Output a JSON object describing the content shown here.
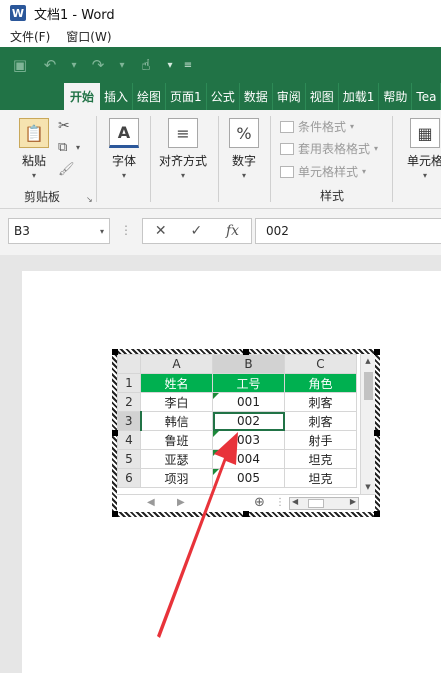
{
  "window": {
    "title": "文档1 - Word",
    "logo": "W"
  },
  "menu": [
    "文件(F)",
    "窗口(W)"
  ],
  "tabs": [
    "开始",
    "插入",
    "绘图",
    "页面1",
    "公式",
    "数据",
    "审阅",
    "视图",
    "加载1",
    "帮助",
    "Tea"
  ],
  "ribbon": {
    "clipboard": {
      "paste": "粘贴",
      "label": "剪贴板"
    },
    "font": "字体",
    "alignment": "对齐方式",
    "number": "数字",
    "number_symbol": "%",
    "styles": {
      "conditional": "条件格式",
      "table": "套用表格格式",
      "cell": "单元格样式",
      "label": "样式"
    },
    "cells": "单元格"
  },
  "formula_bar": {
    "name_box": "B3",
    "fx": "fx",
    "value": "002"
  },
  "sheet": {
    "columns": [
      "A",
      "B",
      "C"
    ],
    "rows": [
      "1",
      "2",
      "3",
      "4",
      "5",
      "6"
    ],
    "header": [
      "姓名",
      "工号",
      "角色"
    ],
    "data": [
      [
        "李白",
        "001",
        "刺客"
      ],
      [
        "韩信",
        "002",
        "刺客"
      ],
      [
        "鲁班",
        "003",
        "射手"
      ],
      [
        "亚瑟",
        "004",
        "坦克"
      ],
      [
        "项羽",
        "005",
        "坦克"
      ]
    ]
  },
  "colors": {
    "excel_green": "#217346",
    "header_green": "#00b050",
    "arrow_red": "#e8333a"
  }
}
